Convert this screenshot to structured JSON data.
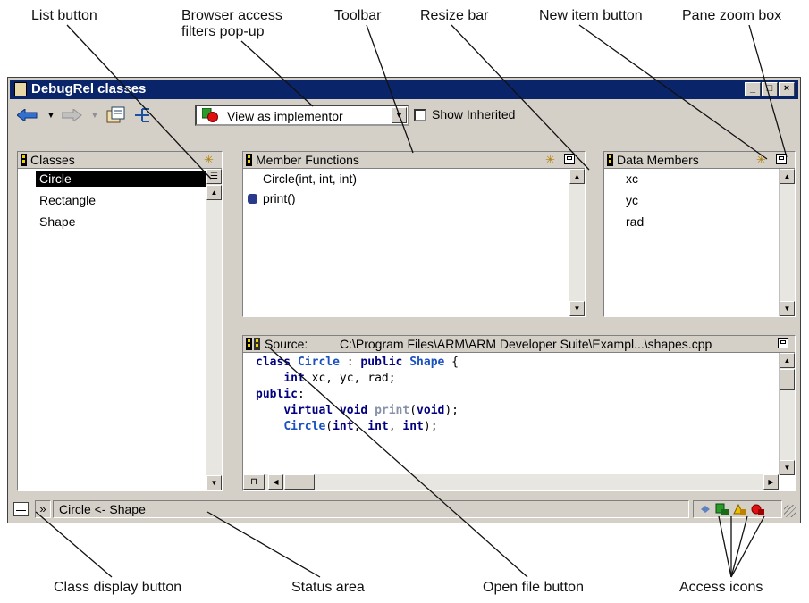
{
  "callouts": {
    "list_button": "List button",
    "access_filters": "Browser access",
    "access_filters_2": "filters pop-up",
    "toolbar": "Toolbar",
    "resize_bar": "Resize bar",
    "new_item_button": "New item button",
    "pane_zoom_box": "Pane zoom box",
    "class_display_button": "Class display button",
    "status_area": "Status area",
    "open_file_button": "Open file button",
    "access_icons": "Access icons"
  },
  "window": {
    "title": "DebugRel classes",
    "minimize": "_",
    "maximize": "□",
    "close": "×"
  },
  "toolbar": {
    "access_filter_value": "View as implementor",
    "show_inherited_label": "Show Inherited",
    "show_inherited_checked": false
  },
  "classes_pane": {
    "title": "Classes",
    "items": [
      "Circle",
      "Rectangle",
      "Shape"
    ],
    "selected": "Circle"
  },
  "member_functions_pane": {
    "title": "Member Functions",
    "items": [
      "Circle(int, int, int)",
      "print()"
    ]
  },
  "data_members_pane": {
    "title": "Data Members",
    "items": [
      "xc",
      "yc",
      "rad"
    ]
  },
  "source_pane": {
    "label": "Source:",
    "path": "C:\\Program Files\\ARM\\ARM Developer Suite\\Exampl...\\shapes.cpp",
    "lines": [
      "class Circle : public Shape {",
      "    int xc, yc, rad;",
      "public:",
      "    virtual void print(void);",
      "    Circle(int, int, int);"
    ]
  },
  "status": {
    "text": "Circle <- Shape",
    "expand_label": "»"
  },
  "icons": {
    "back": "back-arrow-icon",
    "forward": "forward-arrow-icon",
    "access_filter": "access-filter-icon",
    "access_public": "public-access-icon",
    "access_protected": "protected-access-icon",
    "access_private": "private-access-icon"
  },
  "colors": {
    "titlebar": "#0a246a",
    "keyword": "#000080",
    "class_name": "#1a50c0",
    "selection": "#000000"
  }
}
